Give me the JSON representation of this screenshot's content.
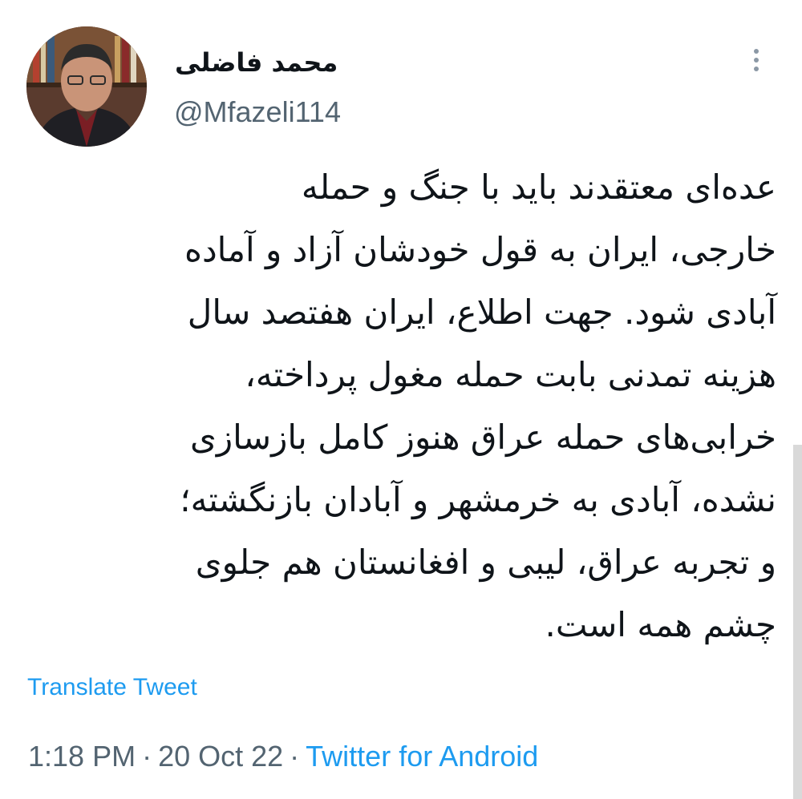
{
  "author": {
    "display_name": "محمد فاضلی",
    "handle": "@Mfazeli114",
    "avatar_icon": "profile-photo"
  },
  "tweet": {
    "lines": [
      "عده‌ای معتقدند باید با جنگ و حمله",
      "خارجی، ایران به قول خودشان آزاد و آماده",
      "آبادی شود. جهت اطلاع، ایران هفتصد سال",
      "هزینه تمدنی بابت حمله مغول پرداخته،",
      "خرابی‌های حمله عراق  هنوز کامل بازسازی",
      "نشده، آبادی به خرمشهر و آبادان بازنگشته؛",
      "و تجربه عراق، لیبی و افغانستان هم جلوی",
      "چشم همه است."
    ]
  },
  "translate_label": "Translate Tweet",
  "meta": {
    "time": "1:18 PM",
    "separator": "·",
    "date": "20 Oct 22",
    "source": "Twitter for Android"
  },
  "colors": {
    "link": "#1d9bf0",
    "secondary_text": "#536471",
    "primary_text": "#0f1419"
  }
}
